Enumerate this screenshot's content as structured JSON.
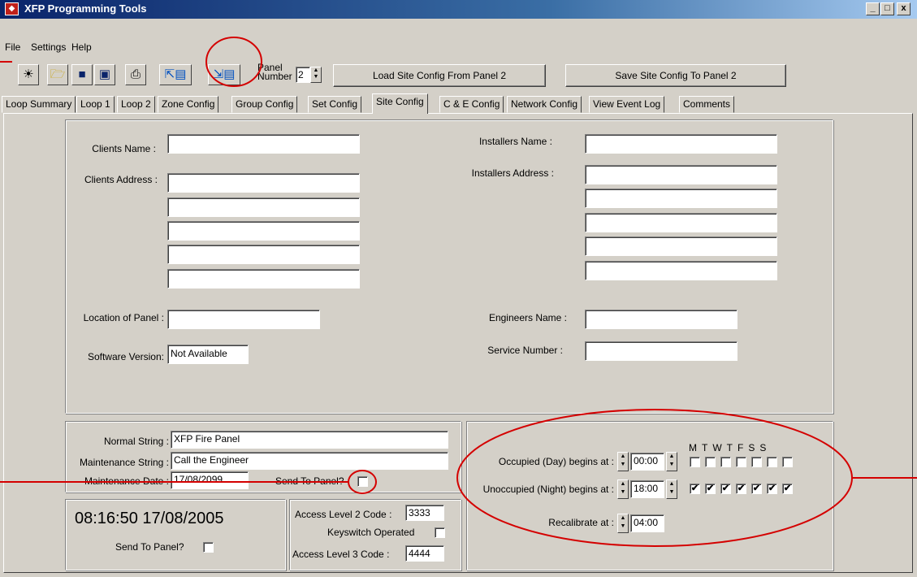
{
  "window": {
    "title": "XFP Programming Tools",
    "controls": [
      "_",
      "□",
      "x"
    ]
  },
  "menu": [
    "File",
    "Settings",
    "Help"
  ],
  "toolbar": {
    "panel_label_line1": "Panel",
    "panel_label_line2": "Number",
    "panel_number": "2",
    "load_button": "Load Site Config From Panel 2",
    "save_button": "Save Site Config To Panel 2"
  },
  "tabs": [
    "Loop Summary",
    "Loop 1",
    "Loop 2",
    "Zone Config",
    "Group Config",
    "Set Config",
    "Site Config",
    "C & E Config",
    "Network Config",
    "View Event Log",
    "Comments"
  ],
  "active_tab": "Site Config",
  "site": {
    "clients_name_label": "Clients Name :",
    "clients_name": "",
    "clients_address_label": "Clients Address :",
    "clients_address": [
      "",
      "",
      "",
      "",
      ""
    ],
    "installers_name_label": "Installers Name :",
    "installers_name": "",
    "installers_address_label": "Installers Address :",
    "installers_address": [
      "",
      "",
      "",
      "",
      ""
    ],
    "location_label": "Location of Panel :",
    "location": "",
    "engineers_name_label": "Engineers Name :",
    "engineers_name": "",
    "software_version_label": "Software Version:",
    "software_version": "Not Available",
    "service_number_label": "Service Number :",
    "service_number": ""
  },
  "strings": {
    "normal_label": "Normal String :",
    "normal_value": "XFP Fire Panel",
    "maintenance_label": "Maintenance String :",
    "maintenance_value": "Call the Engineer",
    "maint_date_label": "Maintenance Date :",
    "maint_date_value": "17/08/2099",
    "send_to_panel_label": "Send To Panel?"
  },
  "clock": {
    "datetime": "08:16:50  17/08/2005",
    "send_to_panel_label": "Send To Panel?"
  },
  "access": {
    "level2_label": "Access Level 2 Code :",
    "level2_value": "3333",
    "keyswitch_label": "Keyswitch Operated",
    "level3_label": "Access Level 3 Code :",
    "level3_value": "4444"
  },
  "schedule": {
    "days": [
      "M",
      "T",
      "W",
      "T",
      "F",
      "S",
      "S"
    ],
    "occupied_label": "Occupied (Day) begins at :",
    "occupied_time": "00:00",
    "occupied_days": [
      false,
      false,
      false,
      false,
      false,
      false,
      false
    ],
    "unoccupied_label": "Unoccupied (Night) begins at :",
    "unoccupied_time": "18:00",
    "unoccupied_days": [
      true,
      true,
      true,
      true,
      true,
      true,
      true
    ],
    "recalibrate_label": "Recalibrate at :",
    "recalibrate_time": "04:00",
    "check_mark": "✔"
  },
  "colors": {
    "titlebar": "#0a246a",
    "face": "#d4d0c8",
    "annotation": "#d40000"
  }
}
